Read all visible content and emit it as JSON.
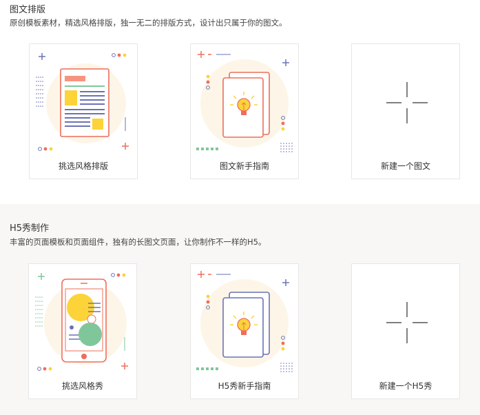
{
  "sections": [
    {
      "title": "图文排版",
      "description": "原创模板素材，精选风格排版，独一无二的排版方式，设计出只属于你的图文。",
      "cards": [
        {
          "label": "挑选风格排版",
          "icon": "document-layout-icon"
        },
        {
          "label": "图文新手指南",
          "icon": "guide-book-lightbulb-icon"
        },
        {
          "label": "新建一个图文",
          "icon": "plus-icon"
        }
      ]
    },
    {
      "title": "H5秀制作",
      "description": "丰富的页面模板和页面组件，独有的长图文页面，让你制作不一样的H5。",
      "cards": [
        {
          "label": "挑选风格秀",
          "icon": "phone-layout-icon"
        },
        {
          "label": "H5秀新手指南",
          "icon": "guide-book-lightbulb-icon"
        },
        {
          "label": "新建一个H5秀",
          "icon": "plus-icon"
        }
      ]
    }
  ],
  "colors": {
    "coral": "#ef6d5a",
    "yellow": "#fcd338",
    "indigo": "#6a72b4",
    "green": "#7fc79a",
    "blob": "#fdf6e8"
  }
}
